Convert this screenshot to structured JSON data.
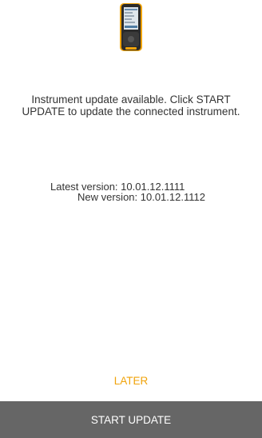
{
  "device": {
    "icon": "measuring-instrument-icon",
    "accent_color": "#f0a30a",
    "body_color": "#2b2b2b"
  },
  "message": {
    "line1": "Instrument update available. Click START",
    "line2": "UPDATE to update the connected instrument."
  },
  "versions": {
    "latest": "Latest version: 10.01.12.1111",
    "new": "New version: 10.01.12.1112"
  },
  "actions": {
    "later_label": "LATER",
    "later_color": "#f0a30a",
    "start_update_label": "START UPDATE",
    "start_update_background": "#666666"
  }
}
